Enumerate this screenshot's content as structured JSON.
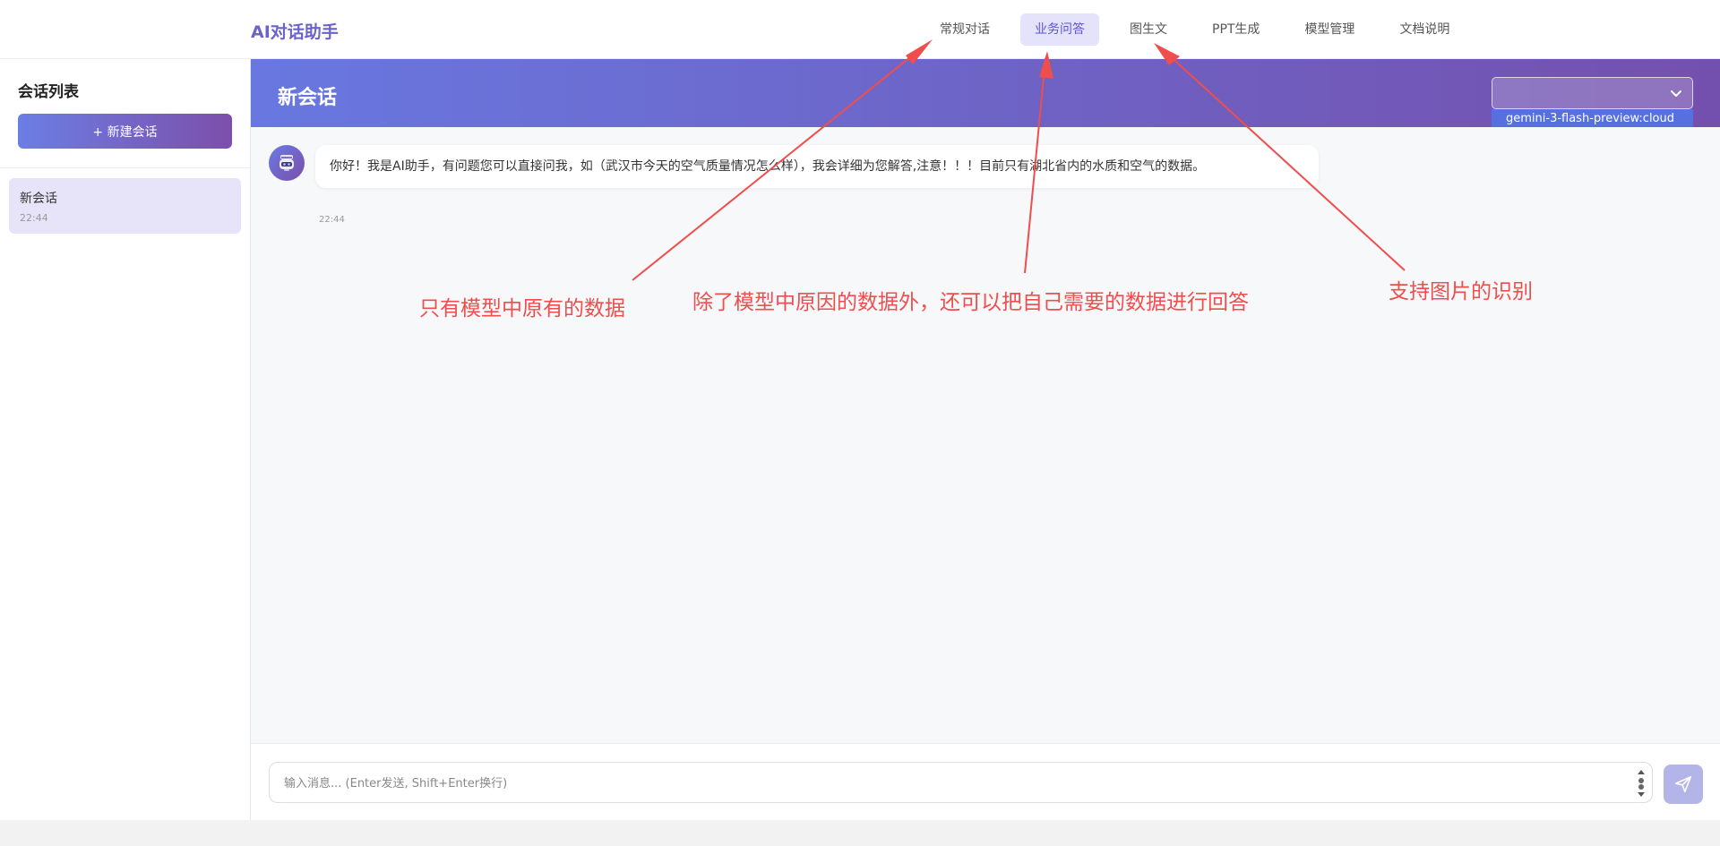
{
  "header": {
    "brand": "AI对话助手",
    "nav": [
      "常规对话",
      "业务问答",
      "图生文",
      "PPT生成",
      "模型管理",
      "文档说明"
    ],
    "active_index": 1
  },
  "sidebar": {
    "title": "会话列表",
    "new_button": "+ 新建会话",
    "conversations": [
      {
        "title": "新会话",
        "time": "22:44"
      }
    ]
  },
  "chat": {
    "title": "新会话",
    "model_select_value": "",
    "model_option": "gemini-3-flash-preview:cloud",
    "messages": [
      {
        "role": "assistant",
        "text": "你好！我是AI助手，有问题您可以直接问我，如（武汉市今天的空气质量情况怎么样），我会详细为您解答,注意！！！目前只有湖北省内的水质和空气的数据。",
        "time": "22:44"
      }
    ]
  },
  "input": {
    "placeholder": "输入消息... (Enter发送, Shift+Enter换行)"
  },
  "annotations": [
    "只有模型中原有的数据",
    "除了模型中原因的数据外，还可以把自己需要的数据进行回答",
    "支持图片的识别"
  ],
  "colors": {
    "accent": "#6b63c9",
    "header_gradient_start": "#6878e0",
    "header_gradient_end": "#7450ad",
    "annotation": "#f04d4d"
  }
}
